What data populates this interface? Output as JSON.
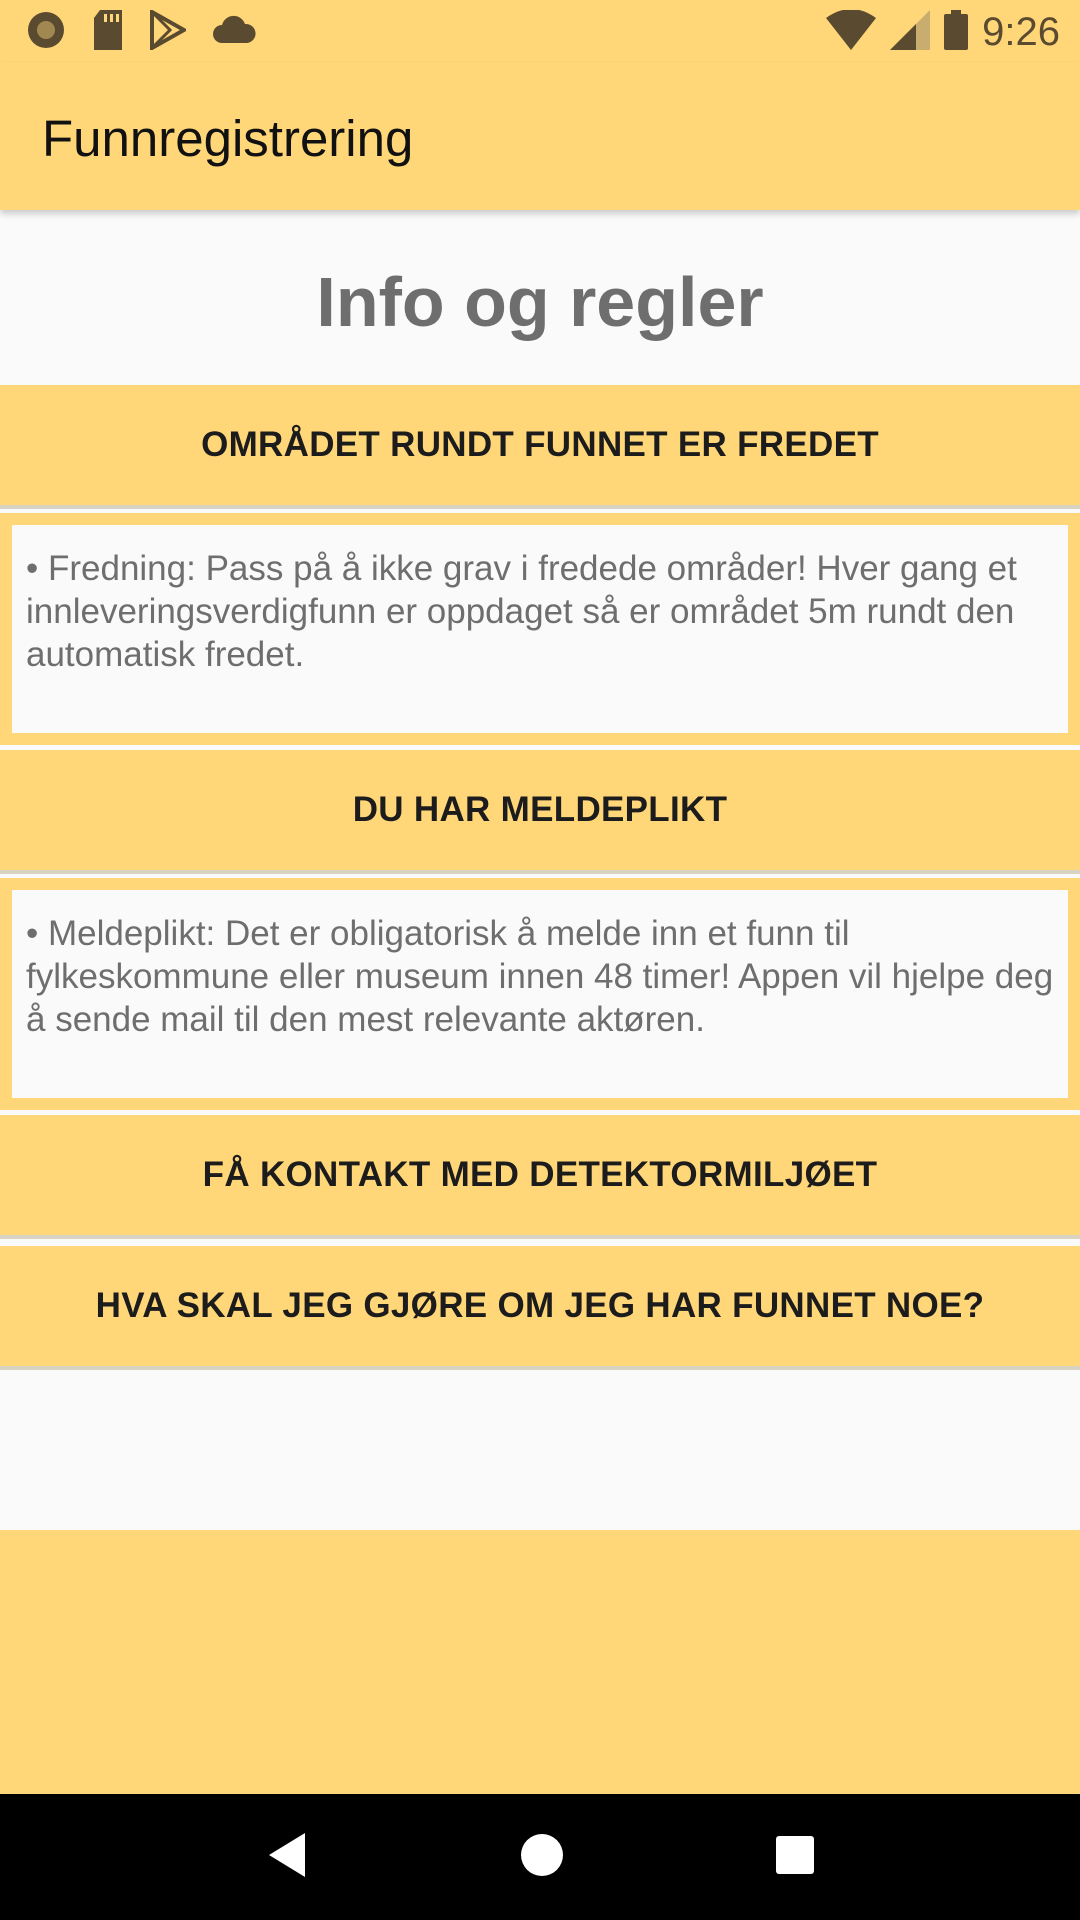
{
  "status_bar": {
    "time": "9:26",
    "left_icons": [
      "record-icon",
      "sd-card-icon",
      "play-store-icon",
      "cloud-icon"
    ],
    "right_icons": [
      "wifi-icon",
      "signal-icon",
      "battery-icon"
    ]
  },
  "app_bar": {
    "title": "Funnregistrering"
  },
  "main": {
    "heading": "Info og regler",
    "sections": [
      {
        "button_label": "OMRÅDET RUNDT FUNNET ER FREDET",
        "expanded": true,
        "body": "• Fredning: Pass på å ikke grav i fredede områder! Hver gang et innleveringsverdigfunn er oppdaget så er området 5m rundt den automatisk fredet."
      },
      {
        "button_label": "DU HAR MELDEPLIKT",
        "expanded": true,
        "body": "• Meldeplikt: Det er obligatorisk å melde inn et funn til fylkeskommune eller museum innen 48 timer! Appen vil hjelpe deg å sende mail til den mest relevante aktøren."
      },
      {
        "button_label": "FÅ KONTAKT MED DETEKTORMILJØET",
        "expanded": false
      },
      {
        "button_label": "HVA SKAL JEG GJØRE OM JEG HAR FUNNET NOE?",
        "expanded": false
      }
    ]
  },
  "nav_bar": {
    "buttons": [
      "back-icon",
      "home-icon",
      "recents-icon"
    ]
  },
  "colors": {
    "accent": "#ffd678",
    "heading_text": "#6e6e6e",
    "content_bg": "#fafafa",
    "nav_bg": "#000000"
  }
}
